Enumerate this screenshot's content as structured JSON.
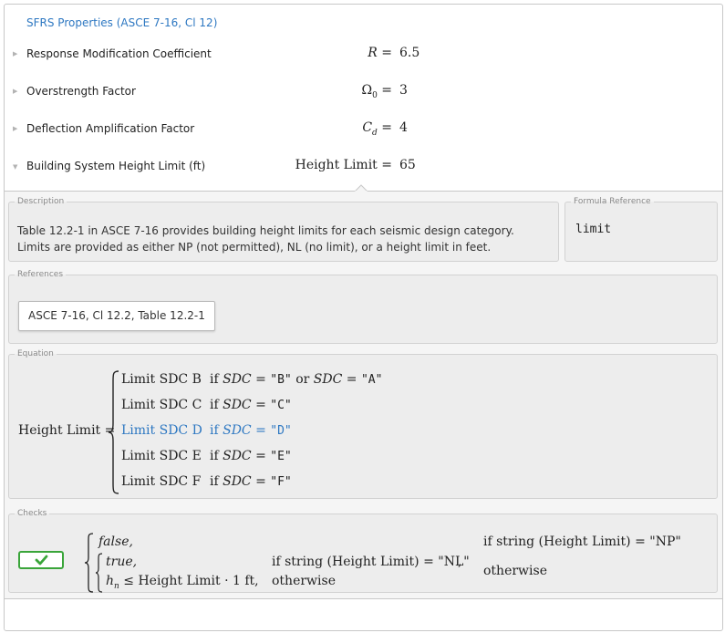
{
  "header": {
    "title": "SFRS Properties (ASCE 7-16, Cl 12)"
  },
  "properties": [
    {
      "label": "Response Modification Coefficient",
      "symbol": "R",
      "subscript": "",
      "value": "6.5",
      "expanded": false
    },
    {
      "label": "Overstrength Factor",
      "symbol": "Ω",
      "subscript": "0",
      "value": "3",
      "expanded": false
    },
    {
      "label": "Deflection Amplification Factor",
      "symbol": "C",
      "subscript": "d",
      "value": "4",
      "expanded": false
    },
    {
      "label": "Building System Height Limit (ft)",
      "symbol": "Height Limit",
      "subscript": "",
      "value": "65",
      "expanded": true
    }
  ],
  "detail": {
    "description": {
      "legend": "Description",
      "text": "Table 12.2-1 in ASCE 7-16 provides building height limits for each seismic design category. Limits are provided as either NP (not permitted), NL (no limit), or a height limit in feet."
    },
    "formula_reference": {
      "legend": "Formula Reference",
      "value": "limit"
    },
    "references": {
      "legend": "References",
      "button": "ASCE 7-16, Cl 12.2, Table 12.2-1"
    },
    "equation": {
      "legend": "Equation",
      "lhs": "Height Limit",
      "cases": [
        {
          "value": "Limit SDC B",
          "cond_var": "SDC",
          "cond_val": "\"B\"",
          "or_var": "SDC",
          "or_val": "\"A\"",
          "active": false
        },
        {
          "value": "Limit SDC C",
          "cond_var": "SDC",
          "cond_val": "\"C\"",
          "active": false
        },
        {
          "value": "Limit SDC D",
          "cond_var": "SDC",
          "cond_val": "\"D\"",
          "active": true
        },
        {
          "value": "Limit SDC E",
          "cond_var": "SDC",
          "cond_val": "\"E\"",
          "active": false
        },
        {
          "value": "Limit SDC F",
          "cond_var": "SDC",
          "cond_val": "\"F\"",
          "active": false
        }
      ]
    },
    "checks": {
      "legend": "Checks",
      "status": "pass",
      "check_color": "#3aa53a",
      "false_label": "false,",
      "true_label": "true,",
      "h_var": "h",
      "h_sub": "n",
      "inner_rhs": "Height Limit · 1 ft,",
      "inner_cond_nl": "if string (Height Limit) = \"NL\"",
      "inner_otherwise": "otherwise",
      "outer_cond_np": "if string (Height Limit) = \"NP\"",
      "outer_otherwise": "otherwise"
    }
  },
  "colors": {
    "link": "#2e78c2",
    "active_case": "#2e78c2",
    "panel_bg": "#ededed"
  }
}
